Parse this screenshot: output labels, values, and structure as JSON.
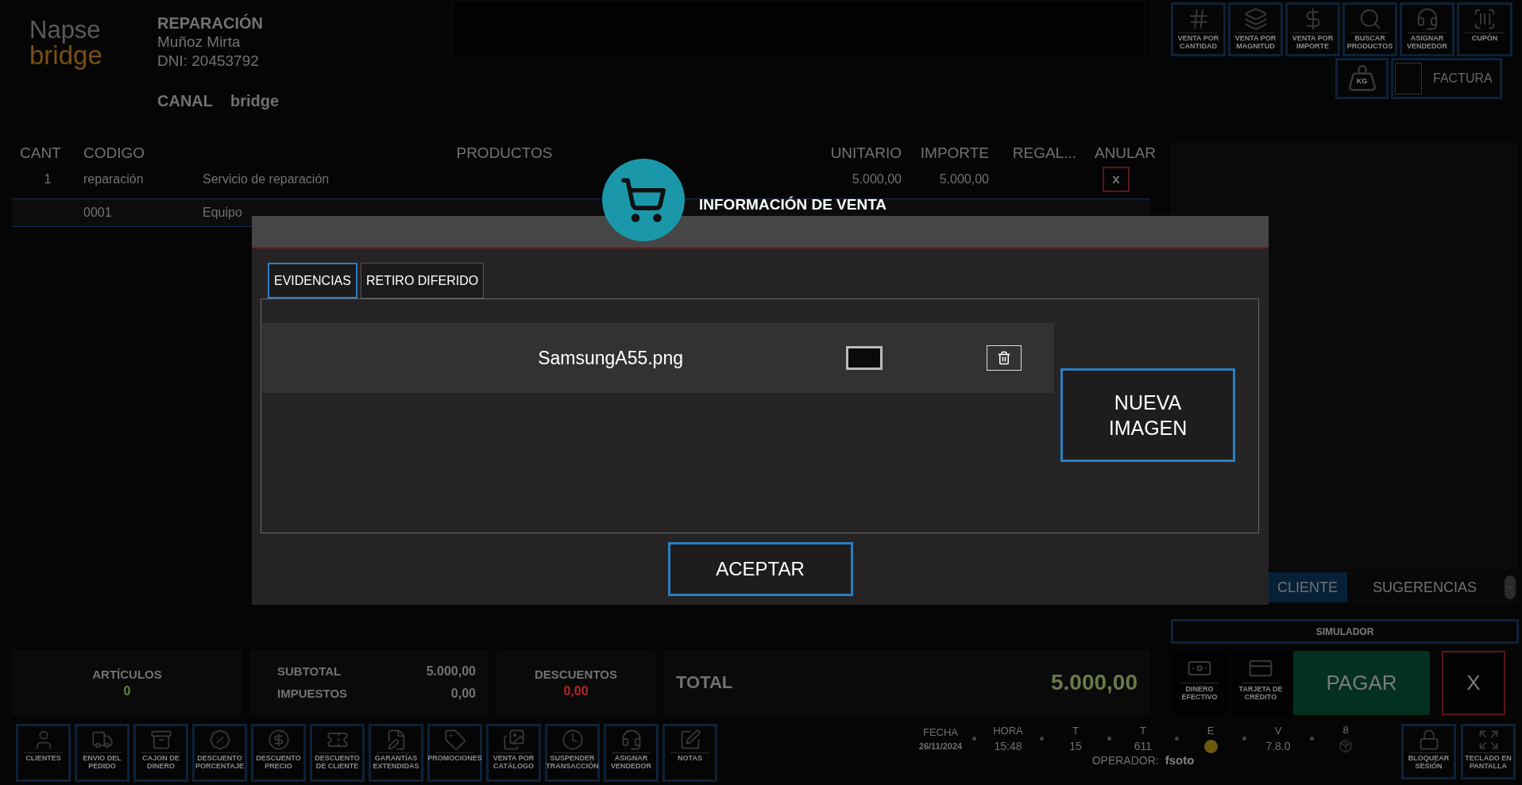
{
  "logo": {
    "line1": "Napse",
    "line2": "bridge"
  },
  "customer": {
    "type": "REPARACIÓN",
    "name": "Muñoz Mirta",
    "dni": "DNI: 20453792"
  },
  "canal": {
    "label": "CANAL",
    "value": "bridge"
  },
  "top_toolbar": [
    "VENTA POR CANTIDAD",
    "VENTA POR MAGNITUD",
    "VENTA POR IMPORTE",
    "BUSCAR PRODUCTOS",
    "ASIGNAR VENDEDOR",
    "CUPÓN"
  ],
  "scale_button": {
    "label": "KG"
  },
  "invoice": {
    "label": "FACTURA",
    "checked": false
  },
  "table": {
    "columns": [
      "CANT",
      "CODIGO",
      "PRODUCTOS",
      "UNITARIO",
      "IMPORTE",
      "REGAL...",
      "ANULAR"
    ],
    "rows": [
      {
        "cant": "1",
        "codigo": "reparación",
        "producto": "Servicio de reparación",
        "unitario": "5.000,00",
        "importe": "5.000,00",
        "anular": "x",
        "selected": false
      },
      {
        "cant": "",
        "codigo": "0001",
        "producto": "Equipo",
        "unitario": "",
        "importe": "",
        "anular": "",
        "selected": true
      }
    ]
  },
  "side_tabs": [
    {
      "label": "CLIENTE",
      "selected": true
    },
    {
      "label": "SUGERENCIAS",
      "selected": false
    }
  ],
  "simulator": "SIMULADOR",
  "totals": {
    "articulos_label": "ARTÍCULOS",
    "articulos": "0",
    "subtotal_label": "SUBTOTAL",
    "subtotal": "5.000,00",
    "impuestos_label": "IMPUESTOS",
    "impuestos": "0,00",
    "descuentos_label": "DESCUENTOS",
    "descuentos": "0,00",
    "total_label": "TOTAL",
    "total": "5.000,00"
  },
  "payment_methods": [
    "DINERO EFECTIVO",
    "TARJETA DE CRÉDITO"
  ],
  "pay": "PAGAR",
  "cancel": "X",
  "bottom_toolbar": [
    "CLIENTES",
    "ENVIO DEL PEDIDO",
    "CAJON DE DINERO",
    "DESCUENTO PORCENTAJE",
    "DESCUENTO PRECIO",
    "DESCUENTO DE CLIENTE",
    "GARANTÍAS EXTENDIDAS",
    "PROMOCIONES",
    "VENTA POR CATÁLOGO",
    "SUSPENDER TRANSACCIÓN",
    "ASIGNAR VENDEDOR",
    "NOTAS"
  ],
  "status": [
    {
      "kind": "text",
      "label": "FECHA",
      "value": "26/11/2024"
    },
    {
      "kind": "text",
      "label": "HORA",
      "value": "15:48"
    },
    {
      "kind": "text",
      "label": "T",
      "value": "15"
    },
    {
      "kind": "text",
      "label": "T",
      "value": "611"
    },
    {
      "kind": "dot",
      "label": "E"
    },
    {
      "kind": "text",
      "label": "V",
      "value": "7.8.0"
    },
    {
      "kind": "icon",
      "label": "8"
    }
  ],
  "operator": {
    "label": "OPERADOR:",
    "value": "fsoto"
  },
  "session_buttons": [
    "BLOQUEAR SESIÓN",
    "TECLADO EN PANTALLA"
  ],
  "modal": {
    "title": "INFORMACIÓN DE VENTA",
    "tabs": [
      {
        "label": "EVIDENCIAS",
        "selected": true
      },
      {
        "label": "RETIRO DIFERIDO",
        "selected": false
      }
    ],
    "files": [
      {
        "name": "SamsungA55.png"
      }
    ],
    "new_image": "NUEVA IMAGEN",
    "accept": "ACEPTAR"
  }
}
